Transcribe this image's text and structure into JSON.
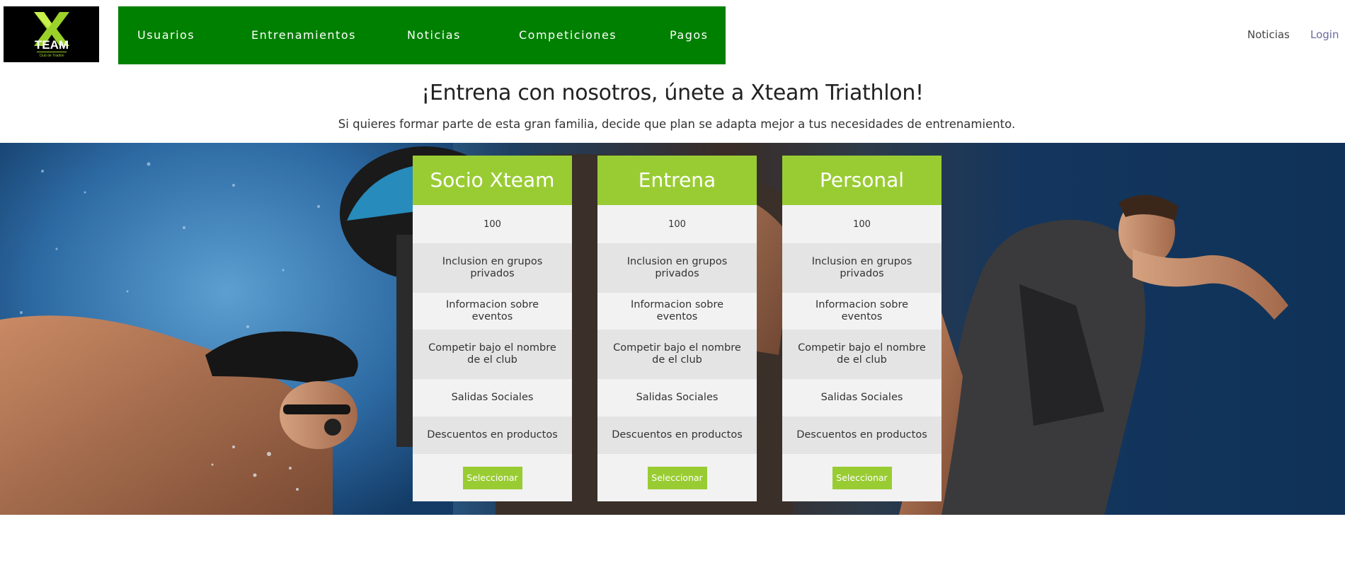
{
  "logo": {
    "mark": "X",
    "word": "TEAM",
    "tagline": "Club de Triatlón"
  },
  "nav": [
    {
      "label": "Usuarios"
    },
    {
      "label": "Entrenamientos"
    },
    {
      "label": "Noticias"
    },
    {
      "label": "Competiciones"
    },
    {
      "label": "Pagos"
    }
  ],
  "right_nav": {
    "news_label": "Noticias",
    "login_label": "Login"
  },
  "headline": "¡Entrena con nosotros, únete a Xteam Triathlon!",
  "subhead": "Si quieres formar parte de esta gran familia, decide que plan se adapta mejor a tus necesidades de entrenamiento.",
  "colors": {
    "nav_bg": "#008000",
    "accent": "#99cc33",
    "card_bg": "#f2f2f2",
    "card_alt": "#e4e4e4"
  },
  "plans": [
    {
      "name": "Socio Xteam",
      "price": "100",
      "features": [
        "Inclusion en grupos privados",
        "Informacion sobre eventos",
        "Competir bajo el nombre de el club",
        "Salidas Sociales",
        "Descuentos en productos"
      ],
      "button": "Seleccionar"
    },
    {
      "name": "Entrena",
      "price": "100",
      "features": [
        "Inclusion en grupos privados",
        "Informacion sobre eventos",
        "Competir bajo el nombre de el club",
        "Salidas Sociales",
        "Descuentos en productos"
      ],
      "button": "Seleccionar"
    },
    {
      "name": "Personal",
      "price": "100",
      "features": [
        "Inclusion en grupos privados",
        "Informacion sobre eventos",
        "Competir bajo el nombre de el club",
        "Salidas Sociales",
        "Descuentos en productos"
      ],
      "button": "Seleccionar"
    }
  ]
}
